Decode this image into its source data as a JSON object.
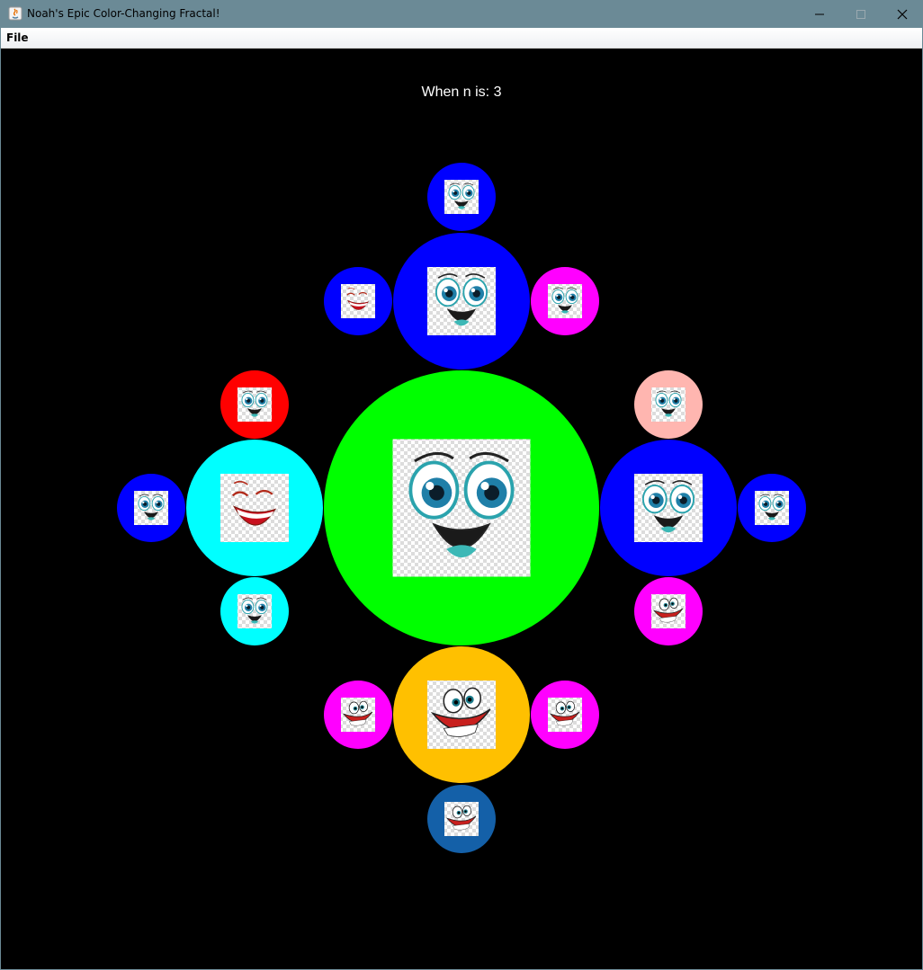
{
  "window": {
    "title": "Noah's Epic Color-Changing Fractal!",
    "titlebar_color": "#6b8a96"
  },
  "menu": {
    "items": [
      "File"
    ]
  },
  "canvas": {
    "background": "#000000",
    "label": "When n is: 3"
  },
  "fractal": {
    "n": 3,
    "nodes": [
      {
        "id": "center",
        "color": "#00ff00",
        "face": "smile"
      },
      {
        "id": "top",
        "color": "#0000ff",
        "face": "smile"
      },
      {
        "id": "left",
        "color": "#00ffff",
        "face": "laugh"
      },
      {
        "id": "right",
        "color": "#0000ff",
        "face": "smile"
      },
      {
        "id": "bottom",
        "color": "#ffc000",
        "face": "goofy"
      },
      {
        "id": "top-top",
        "color": "#0000ff",
        "face": "smile"
      },
      {
        "id": "top-left",
        "color": "#0000ff",
        "face": "laugh"
      },
      {
        "id": "top-right",
        "color": "#ff00ff",
        "face": "smile"
      },
      {
        "id": "left-top",
        "color": "#ff0000",
        "face": "smile"
      },
      {
        "id": "left-left",
        "color": "#0000ff",
        "face": "smile"
      },
      {
        "id": "left-bottom",
        "color": "#00ffff",
        "face": "smile"
      },
      {
        "id": "right-top",
        "color": "#ffb6b0",
        "face": "smile"
      },
      {
        "id": "right-right",
        "color": "#0000ff",
        "face": "smile"
      },
      {
        "id": "right-bottom",
        "color": "#ff00ff",
        "face": "goofy"
      },
      {
        "id": "bottom-left",
        "color": "#ff00ff",
        "face": "goofy"
      },
      {
        "id": "bottom-right",
        "color": "#ff00ff",
        "face": "goofy"
      },
      {
        "id": "bottom-bottom",
        "color": "#1460a8",
        "face": "goofy"
      }
    ]
  }
}
